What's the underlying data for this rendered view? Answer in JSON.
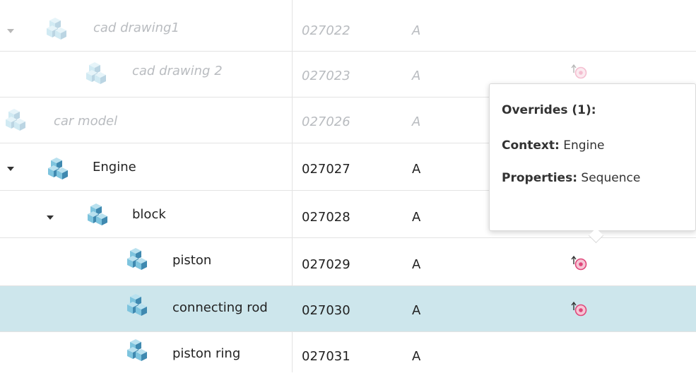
{
  "rows": [
    {
      "name": "cad drawing1",
      "number": "027022",
      "revision": "A",
      "ghost": true
    },
    {
      "name": "cad drawing 2",
      "number": "027023",
      "revision": "A",
      "ghost": true
    },
    {
      "name": "car model",
      "number": "027026",
      "revision": "A",
      "ghost": true
    },
    {
      "name": "Engine",
      "number": "027027",
      "revision": "A",
      "ghost": false
    },
    {
      "name": "block",
      "number": "027028",
      "revision": "A",
      "ghost": false
    },
    {
      "name": "piston",
      "number": "027029",
      "revision": "A",
      "ghost": false
    },
    {
      "name": "connecting rod",
      "number": "027030",
      "revision": "A",
      "ghost": false,
      "selected": true
    },
    {
      "name": "piston ring",
      "number": "027031",
      "revision": "A",
      "ghost": false
    }
  ],
  "tooltip": {
    "title": "Overrides (1):",
    "context_key": "Context:",
    "context_value": "Engine",
    "properties_key": "Properties:",
    "properties_value": "Sequence"
  },
  "icons": {
    "part": "part-cube-icon",
    "override": "override-target-icon",
    "expand": "caret-down-icon"
  },
  "colors": {
    "selected_row": "#cde6ec",
    "ghost_text": "#b9bcc0",
    "icon_blue": "#3f89b0",
    "override_pink": "#e0477a"
  }
}
